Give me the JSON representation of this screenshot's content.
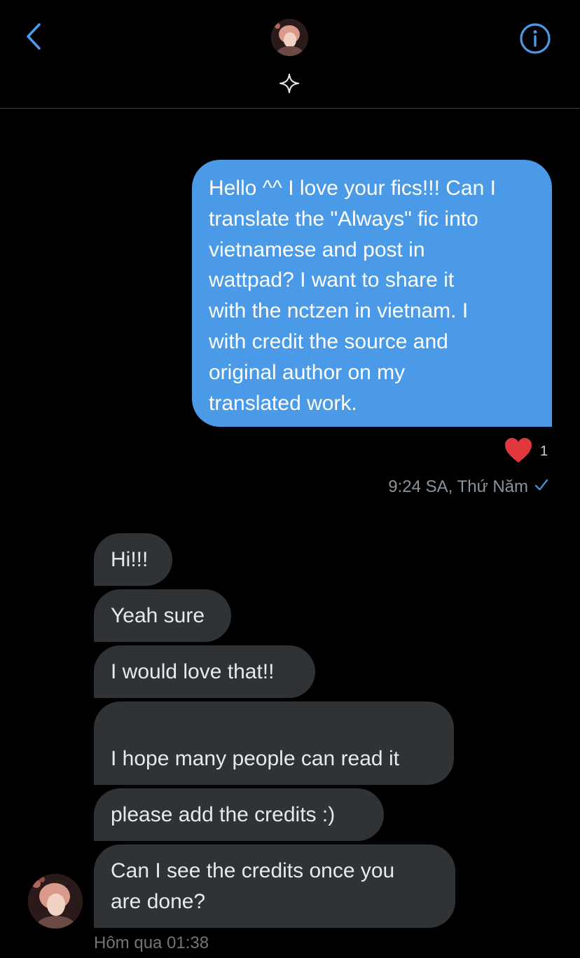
{
  "header": {
    "back_icon": "chevron-left-icon",
    "avatar": "user-avatar",
    "verified_icon": "sparkle-icon",
    "info_icon": "info-circle-icon",
    "accent_color": "#4a9ae7"
  },
  "sent_message": {
    "text": "Hello ^^ I love your fics!!! Can I\ntranslate the \"Always\" fic into\nvietnamese and post in\nwattpad? I want to share it\nwith the nctzen in vietnam. I\nwith credit the source and\noriginal author on my\ntranslated work.",
    "reaction_icon": "heart-icon",
    "reaction_count": "1",
    "timestamp": "9:24 SA, Thứ Năm",
    "status_icon": "checkmark-icon",
    "bubble_color": "#4a9ae7"
  },
  "received_messages": [
    {
      "text": "Hi!!!"
    },
    {
      "text": "Yeah sure"
    },
    {
      "text": "I would love that!!"
    },
    {
      "text": "I hope many people can read it",
      "emoji": "🤩"
    },
    {
      "text": "please add the credits :)"
    },
    {
      "text": "Can I see the credits once you\nare done?"
    }
  ],
  "received_meta": {
    "timestamp": "Hôm qua 01:38",
    "bubble_color": "#2f3336"
  }
}
